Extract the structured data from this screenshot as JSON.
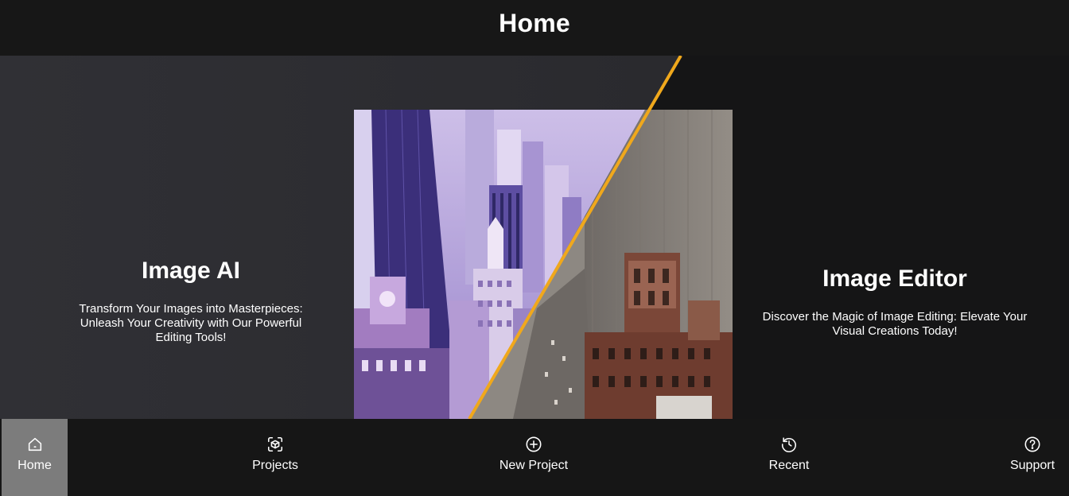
{
  "header": {
    "title": "Home"
  },
  "hero": {
    "left_panel": {
      "title": "Image AI",
      "description": "Transform Your Images into Masterpieces: Unleash Your Creativity with Our Powerful Editing Tools!"
    },
    "right_panel": {
      "title": "Image Editor",
      "description": "Discover the Magic of Image Editing: Elevate Your Visual Creations Today!"
    },
    "divider_color": "#f0a81c",
    "left_bg_color": "#2c2c30",
    "right_bg_color": "#151516"
  },
  "nav": {
    "items": [
      {
        "label": "Home",
        "icon": "home-icon",
        "active": true
      },
      {
        "label": "Projects",
        "icon": "projects-icon",
        "active": false
      },
      {
        "label": "New Project",
        "icon": "plus-circle-icon",
        "active": false
      },
      {
        "label": "Recent",
        "icon": "history-icon",
        "active": false
      },
      {
        "label": "Support",
        "icon": "help-circle-icon",
        "active": false
      }
    ]
  }
}
